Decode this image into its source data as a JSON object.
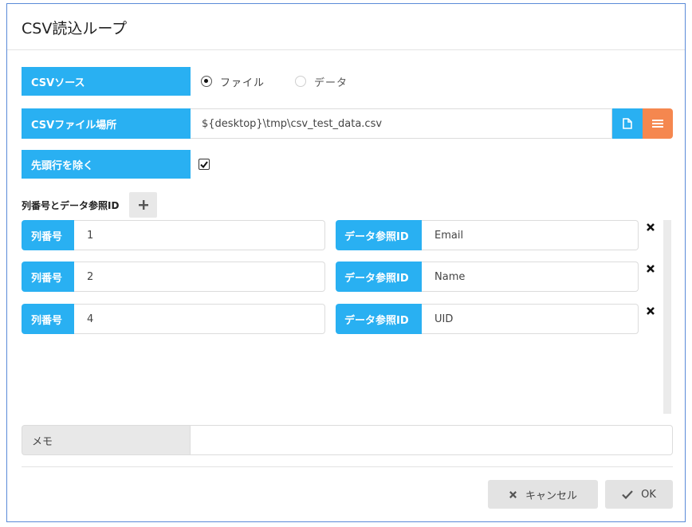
{
  "dialog": {
    "title": "CSV読込ループ"
  },
  "csv_source": {
    "label": "CSVソース",
    "options": [
      "ファイル",
      "データ"
    ],
    "selected": "ファイル"
  },
  "csv_file": {
    "label": "CSVファイル場所",
    "value": "${desktop}\\tmp\\csv_test_data.csv",
    "file_icon": "file-icon",
    "list_icon": "list-icon"
  },
  "skip_header": {
    "label": "先頭行を除く",
    "checked": true
  },
  "mapping": {
    "section_label": "列番号とデータ参照ID",
    "add_icon": "plus-icon",
    "column_label": "列番号",
    "ref_label": "データ参照ID",
    "rows": [
      {
        "column": "1",
        "ref": "Email"
      },
      {
        "column": "2",
        "ref": "Name"
      },
      {
        "column": "4",
        "ref": "UID"
      }
    ]
  },
  "memo": {
    "label": "メモ",
    "value": ""
  },
  "buttons": {
    "cancel": "キャンセル",
    "ok": "OK"
  },
  "colors": {
    "accent_blue": "#29b0f2",
    "accent_orange": "#f5874f",
    "border_blue": "#5a8ad8"
  }
}
